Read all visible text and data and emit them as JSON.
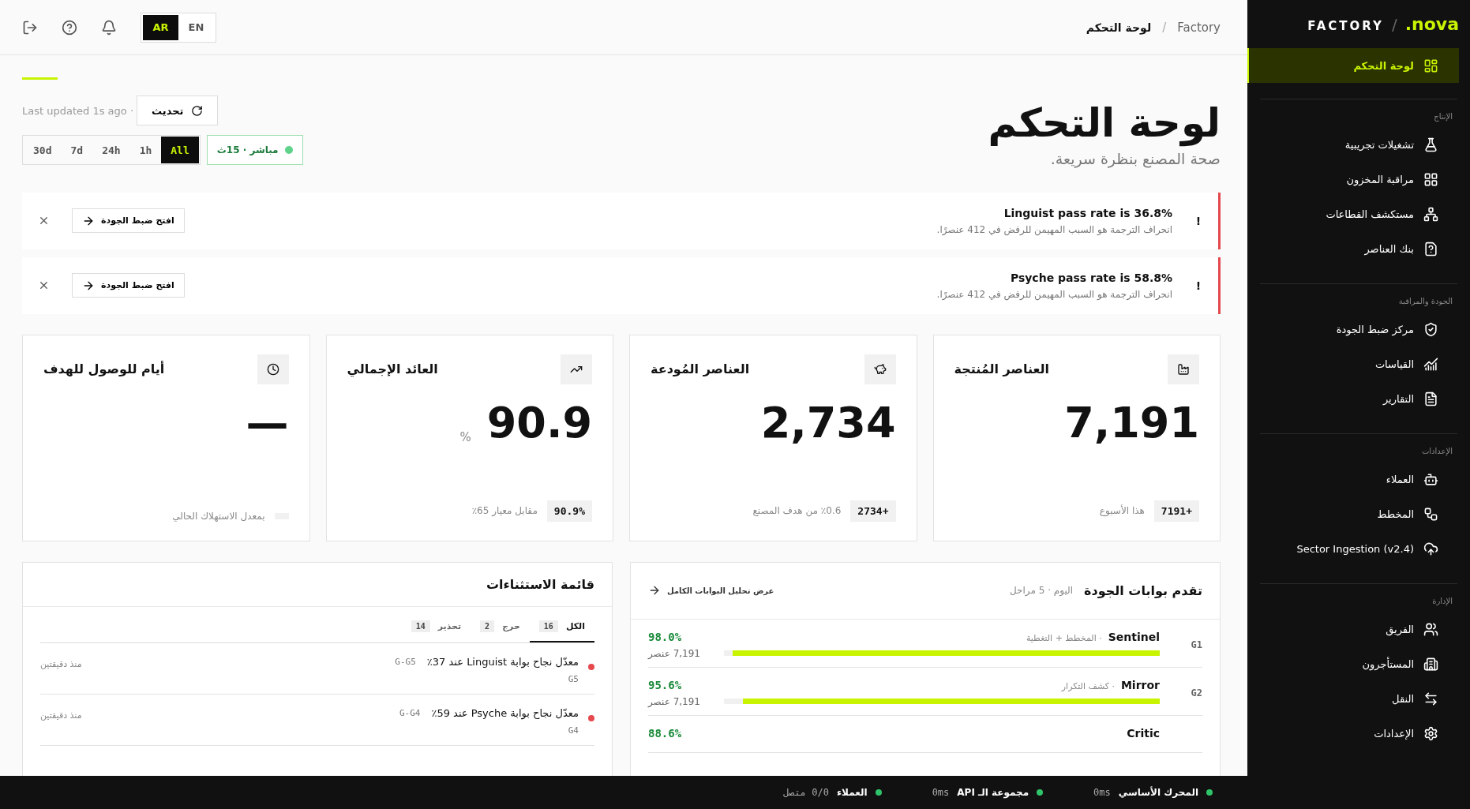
{
  "topbar": {
    "languages": [
      {
        "label": "EN",
        "selected": false
      },
      {
        "label": "AR",
        "selected": true
      }
    ],
    "breadcrumb": {
      "root": "Factory",
      "separator": "/",
      "current": "لوحة التحكم"
    }
  },
  "header": {
    "title": "لوحة التحكم",
    "subtitle": "صحة المصنع بنظرة سريعة.",
    "last_updated": "Last updated 1s ago ·",
    "refresh": "تحديث",
    "ranges": [
      {
        "label": "All",
        "selected": true
      },
      {
        "label": "1h",
        "selected": false
      },
      {
        "label": "24h",
        "selected": false
      },
      {
        "label": "7d",
        "selected": false
      },
      {
        "label": "30d",
        "selected": false
      }
    ],
    "live": {
      "label": "مباشر · 15ث",
      "on": true
    }
  },
  "alerts": [
    {
      "mark": "!",
      "title": "Linguist pass rate is 36.8%",
      "description": "انحراف الترجمة هو السبب المهيمن للرفض في 412 عنصرًا.",
      "action": "افتح ضبط الجودة"
    },
    {
      "mark": "!",
      "title": "Psyche pass rate is 58.8%",
      "description": "انحراف الترجمة هو السبب المهيمن للرفض في 412 عنصرًا.",
      "action": "افتح ضبط الجودة"
    }
  ],
  "kpis": [
    {
      "title": "العناصر المُنتجة",
      "value": "7,191",
      "delta": "+7191",
      "note": "هذا الأسبوع"
    },
    {
      "title": "العناصر المُودعة",
      "value": "2,734",
      "delta": "+2734",
      "note": "٪0.6 من هدف المصنع"
    },
    {
      "title": "العائد الإجمالي",
      "value": "90.9",
      "unit": "%",
      "delta": "90.9%",
      "note": "مقابل معيار 65٪"
    },
    {
      "title": "أيام للوصول للهدف",
      "value": "—",
      "note": "بمعدل الاستهلاك الحالي"
    }
  ],
  "gates": {
    "title": "تقدم بوابات الجودة",
    "subtitle": "اليوم · 5 مراحل",
    "link": "عرض تحليل البوابات الكامل",
    "rows": [
      {
        "code": "G1",
        "name": "Sentinel",
        "detail": "· المخطط + التغطية",
        "percent": "98.0%",
        "count": "7,191 عنصر",
        "level": 0.98
      },
      {
        "code": "G2",
        "name": "Mirror",
        "detail": "· كشف التكرار",
        "percent": "95.6%",
        "count": "7,191 عنصر",
        "level": 0.956
      },
      {
        "name": "Critic",
        "percent": "88.6%"
      }
    ]
  },
  "exceptions": {
    "title": "قائمة الاستثناءات",
    "tabs": [
      {
        "label": "الكل",
        "count": "16",
        "selected": true
      },
      {
        "label": "حرج",
        "count": "2",
        "selected": false
      },
      {
        "label": "تحذير",
        "count": "14",
        "selected": false
      }
    ],
    "rows": [
      {
        "kind": "critical",
        "text": "معدّل نجاح بوابة Linguist عند 37٪",
        "code": "G-G5",
        "gate": "G5",
        "time": "منذ دقيقتين"
      },
      {
        "kind": "critical",
        "text": "معدّل نجاح بوابة Psyche عند 59٪",
        "code": "G-G4",
        "gate": "G4",
        "time": "منذ دقيقتين"
      }
    ]
  },
  "status_bar": [
    {
      "label": "المحرك الأساسي",
      "value": "0ms",
      "online": true
    },
    {
      "label": "مجموعة الـ API",
      "value": "0ms",
      "online": true
    },
    {
      "label": "العملاء",
      "value": "0/0 متصل",
      "online": true
    }
  ],
  "sidebar": {
    "logo": {
      "brand": "FACTORY",
      "separator": "/",
      "product": ".nova"
    },
    "items": [
      {
        "label": "لوحة التحكم",
        "selected": true
      }
    ],
    "sections": [
      {
        "title": "الإنتاج",
        "items": [
          {
            "label": "تشغيلات تجريبية",
            "selected": false
          },
          {
            "label": "مراقبة المخزون",
            "selected": false
          },
          {
            "label": "مستكشف القطاعات",
            "selected": false
          },
          {
            "label": "بنك العناصر",
            "selected": false
          }
        ]
      },
      {
        "title": "الجودة والمراقبة",
        "items": [
          {
            "label": "مركز ضبط الجودة",
            "selected": false
          },
          {
            "label": "القياسات",
            "selected": false
          },
          {
            "label": "التقارير",
            "selected": false
          }
        ]
      },
      {
        "title": "الإعدادات",
        "items": [
          {
            "label": "العملاء",
            "selected": false
          },
          {
            "label": "المخطط",
            "selected": false
          },
          {
            "label": "Sector Ingestion (v2.4)",
            "selected": false
          }
        ]
      },
      {
        "title": "الإدارة",
        "items": [
          {
            "label": "الفريق",
            "selected": false
          },
          {
            "label": "المستأجرون",
            "selected": false
          },
          {
            "label": "النقل",
            "selected": false
          },
          {
            "label": "الإعدادات",
            "selected": false
          }
        ]
      }
    ]
  }
}
